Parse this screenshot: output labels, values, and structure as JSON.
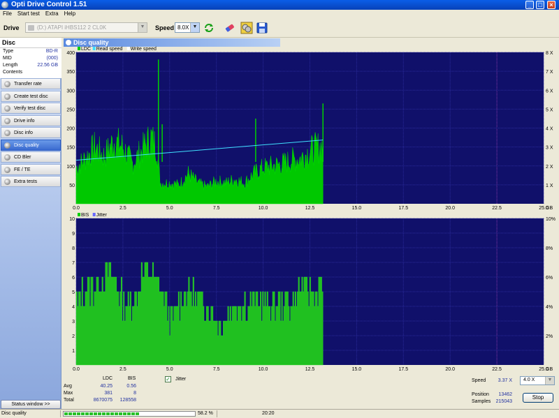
{
  "window": {
    "title": "Opti Drive Control 1.51"
  },
  "menu": [
    "File",
    "Start test",
    "Extra",
    "Help"
  ],
  "toolbar": {
    "drive_label": "Drive",
    "drive_value": "(D:)  ATAPI iHBS112  2 CL0K",
    "speed_label": "Speed",
    "speed_value": "8.0X"
  },
  "disc": {
    "header": "Disc",
    "rows": [
      {
        "k": "Type",
        "v": "BD-R"
      },
      {
        "k": "MID",
        "v": "(000)"
      },
      {
        "k": "Length",
        "v": "22.56 GB"
      },
      {
        "k": "Contents",
        "v": ""
      }
    ]
  },
  "nav": [
    {
      "label": "Transfer rate",
      "active": false
    },
    {
      "label": "Create test disc",
      "active": false
    },
    {
      "label": "Verify test disc",
      "active": false
    },
    {
      "label": "Drive info",
      "active": false
    },
    {
      "label": "Disc info",
      "active": false
    },
    {
      "label": "Disc quality",
      "active": true
    },
    {
      "label": "CD Bler",
      "active": false
    },
    {
      "label": "FE / TE",
      "active": false
    },
    {
      "label": "Extra tests",
      "active": false
    }
  ],
  "status_window_label": "Status window >>",
  "panel_title": "Disc quality",
  "chart_data": [
    {
      "type": "area",
      "legend": [
        "LDC",
        "Read speed",
        "Write speed"
      ],
      "legend_colors": [
        "#00d000",
        "#40e0ff",
        "#ffffff"
      ],
      "x_ticks": [
        0.0,
        2.5,
        5.0,
        7.5,
        10.0,
        12.5,
        15.0,
        17.5,
        20.0,
        22.5,
        25.0
      ],
      "x_unit": "GB",
      "xlim": [
        0,
        25
      ],
      "y_ticks": [
        50,
        100,
        150,
        200,
        250,
        300,
        350,
        400
      ],
      "ylim": [
        0,
        400
      ],
      "y2_ticks": [
        "1 X",
        "2 X",
        "3 X",
        "4 X",
        "5 X",
        "6 X",
        "7 X",
        "8 X"
      ],
      "y2lim": [
        0,
        8
      ],
      "ldc_x": [
        0.0,
        0.5,
        1.0,
        1.5,
        2.0,
        2.5,
        3.0,
        3.5,
        4.0,
        4.3,
        4.5,
        5.0,
        5.5,
        6.0,
        6.5,
        7.0,
        7.5,
        8.0,
        8.5,
        9.0,
        9.5,
        10.0,
        10.5,
        11.0,
        11.5,
        12.0,
        12.5,
        13.0,
        13.2
      ],
      "ldc_y": [
        95,
        120,
        150,
        125,
        165,
        150,
        105,
        140,
        175,
        150,
        55,
        55,
        50,
        80,
        55,
        45,
        60,
        55,
        65,
        55,
        80,
        95,
        100,
        105,
        115,
        120,
        140,
        150,
        155
      ],
      "ldc_spikes": [
        {
          "x": 4.4,
          "y": 381
        },
        {
          "x": 13.2,
          "y": 265
        },
        {
          "x": 4.6,
          "y": 210
        },
        {
          "x": 9.6,
          "y": 225
        }
      ],
      "speed_x": [
        0.0,
        13.2
      ],
      "speed_y": [
        2.3,
        3.37
      ]
    },
    {
      "type": "area",
      "legend": [
        "BIS",
        "Jitter"
      ],
      "legend_colors": [
        "#00d000",
        "#6a6aff"
      ],
      "x_ticks": [
        0.0,
        2.5,
        5.0,
        7.5,
        10.0,
        12.5,
        15.0,
        17.5,
        20.0,
        22.5,
        25.0
      ],
      "x_unit": "GB",
      "xlim": [
        0,
        25
      ],
      "y_ticks": [
        1,
        2,
        3,
        4,
        5,
        6,
        7,
        8,
        9,
        10
      ],
      "ylim": [
        0,
        10
      ],
      "y2_ticks": [
        "2%",
        "4%",
        "6%",
        "8%",
        "10%"
      ],
      "bis_x": [
        0.0,
        0.5,
        1.0,
        1.5,
        2.0,
        2.5,
        3.0,
        3.5,
        4.0,
        4.5,
        5.0,
        5.5,
        6.0,
        6.5,
        7.0,
        7.5,
        8.0,
        8.5,
        9.0,
        9.5,
        10.0,
        10.5,
        11.0,
        11.5,
        12.0,
        12.5,
        13.0,
        13.2
      ],
      "bis_y": [
        4,
        5,
        5,
        6,
        6,
        4,
        4,
        6,
        6,
        5,
        3,
        4,
        5,
        4,
        4,
        3,
        3,
        4,
        4,
        4,
        4,
        4,
        4,
        4,
        5,
        5,
        5,
        5
      ]
    }
  ],
  "stats": {
    "col_ldc": "LDC",
    "col_bis": "BIS",
    "rows": [
      {
        "label": "Avg",
        "ldc": "40.25",
        "bis": "0.56"
      },
      {
        "label": "Max",
        "ldc": "381",
        "bis": "8"
      },
      {
        "label": "Total",
        "ldc": "8670075",
        "bis": "128558"
      }
    ],
    "jitter_label": "Jitter",
    "speed_label": "Speed",
    "speed_value": "3.37 X",
    "speed_select": "4.0 X",
    "position_label": "Position",
    "position_value": "13462",
    "samples_label": "Samples",
    "samples_value": "215043",
    "stop_label": "Stop"
  },
  "statusbar": {
    "left": "Disc quality",
    "percent": "58.2 %",
    "progress": 0.582,
    "time": "20:20"
  }
}
